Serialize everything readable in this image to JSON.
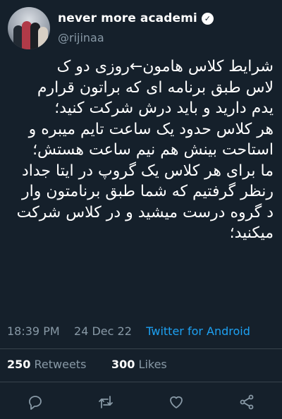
{
  "author": {
    "display_name": "never more academi",
    "handle": "@rijinaa",
    "verified_symbol": "✓"
  },
  "tweet": {
    "lines": [
      "شرایط کلاس هامون←روزی دو ک",
      "لاس طبق برنامه ای که براتون قرارم",
      "یدم دارید و باید درش شرکت کنید؛",
      "هر کلاس حدود یک ساعت تایم میبره و",
      "استاحت بینش هم نیم ساعت هستش؛",
      "ما برای هر کلاس یک گروپ در ایتا جداد",
      "رنظر گرفتیم که شما طبق برنامتون وار",
      "د گروه درست میشید و در کلاس شرکت",
      "میکنید؛"
    ]
  },
  "meta": {
    "time": "18:39 PM",
    "date": "24 Dec 22",
    "source": "Twitter for Android"
  },
  "stats": {
    "retweets_count": "250",
    "retweets_label": "Retweets",
    "likes_count": "300",
    "likes_label": "Likes"
  },
  "actions": [
    "reply-icon",
    "retweet-icon",
    "like-icon",
    "share-icon"
  ],
  "colors": {
    "background": "#15202b",
    "muted": "#8899a6",
    "link": "#1da1f2",
    "divider": "#38444d"
  }
}
